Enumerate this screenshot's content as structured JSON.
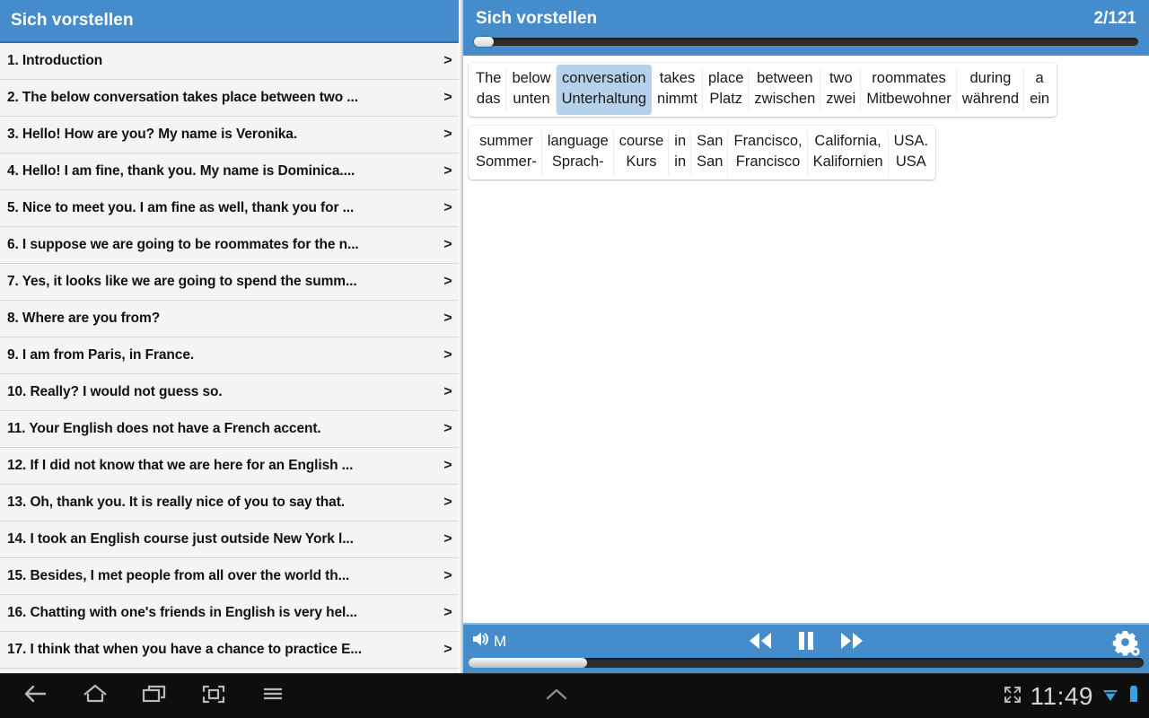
{
  "left_panel": {
    "header_title": "Sich vorstellen",
    "chevron": ">",
    "lessons": [
      {
        "label": "1. Introduction"
      },
      {
        "label": "2. The below conversation takes place between two ..."
      },
      {
        "label": "3. Hello! How are you? My name is Veronika."
      },
      {
        "label": "4. Hello! I am fine, thank you. My name is Dominica...."
      },
      {
        "label": "5. Nice to meet you. I am fine as well, thank you for ..."
      },
      {
        "label": "6. I suppose we are going to be roommates for the n..."
      },
      {
        "label": "7. Yes, it looks like we are going to spend the summ..."
      },
      {
        "label": "8. Where are you from?"
      },
      {
        "label": "9. I am from Paris, in France."
      },
      {
        "label": "10. Really? I would not guess so."
      },
      {
        "label": "11. Your English does not have a French accent."
      },
      {
        "label": "12. If I did not know that we are here for an English ..."
      },
      {
        "label": "13. Oh, thank you. It is really nice of you to say that."
      },
      {
        "label": "14. I took an English course just outside New York l..."
      },
      {
        "label": "15. Besides, I met people from all over the world th..."
      },
      {
        "label": "16. Chatting with one's friends in English is very hel..."
      },
      {
        "label": "17. I think that when you have a chance to practice E..."
      }
    ]
  },
  "right_panel": {
    "header_title": "Sich vorstellen",
    "counter": "2/121",
    "progress_percent": 1,
    "lines": [
      {
        "pairs": [
          {
            "en": "The",
            "de": "das",
            "selected": false
          },
          {
            "en": "below",
            "de": "unten",
            "selected": false
          },
          {
            "en": "conversation",
            "de": "Unterhaltung",
            "selected": true
          },
          {
            "en": "takes",
            "de": "nimmt",
            "selected": false
          },
          {
            "en": "place",
            "de": "Platz",
            "selected": false
          },
          {
            "en": "between",
            "de": "zwischen",
            "selected": false
          },
          {
            "en": "two",
            "de": "zwei",
            "selected": false
          },
          {
            "en": "roommates",
            "de": "Mitbewohner",
            "selected": false
          },
          {
            "en": "during",
            "de": "während",
            "selected": false
          },
          {
            "en": "a",
            "de": "ein",
            "selected": false
          }
        ]
      },
      {
        "pairs": [
          {
            "en": "summer",
            "de": "Sommer-",
            "selected": false
          },
          {
            "en": "language",
            "de": "Sprach-",
            "selected": false
          },
          {
            "en": "course",
            "de": "Kurs",
            "selected": false
          },
          {
            "en": "in",
            "de": "in",
            "selected": false
          },
          {
            "en": "San",
            "de": "San",
            "selected": false
          },
          {
            "en": "Francisco,",
            "de": "Francisco",
            "selected": false
          },
          {
            "en": "California,",
            "de": "Kalifornien",
            "selected": false
          },
          {
            "en": "USA.",
            "de": "USA",
            "selected": false
          }
        ]
      }
    ]
  },
  "player": {
    "volume_label": "M",
    "volume_icon": "speaker-icon",
    "rewind_icon": "rewind-icon",
    "pause_icon": "pause-icon",
    "forward_icon": "fast-forward-icon",
    "settings_icon": "gear-icon",
    "seek_percent": 17.5
  },
  "navbar": {
    "back_icon": "back-arrow-icon",
    "home_icon": "home-icon",
    "recents_icon": "recent-apps-icon",
    "screenshot_icon": "screenshot-icon",
    "menu_icon": "menu-icon",
    "caret_icon": "chevron-up-icon",
    "fullscreen_icon": "fullscreen-icon",
    "clock": "11:49",
    "wifi_icon": "wifi-icon",
    "battery_icon": "battery-icon"
  },
  "colors": {
    "header_blue": "#448ccb",
    "selection_blue": "#b5d2ea",
    "list_bg": "#f4f4f4",
    "navbar_bg": "#0e0e0e",
    "status_blue": "#3aa0e0"
  }
}
